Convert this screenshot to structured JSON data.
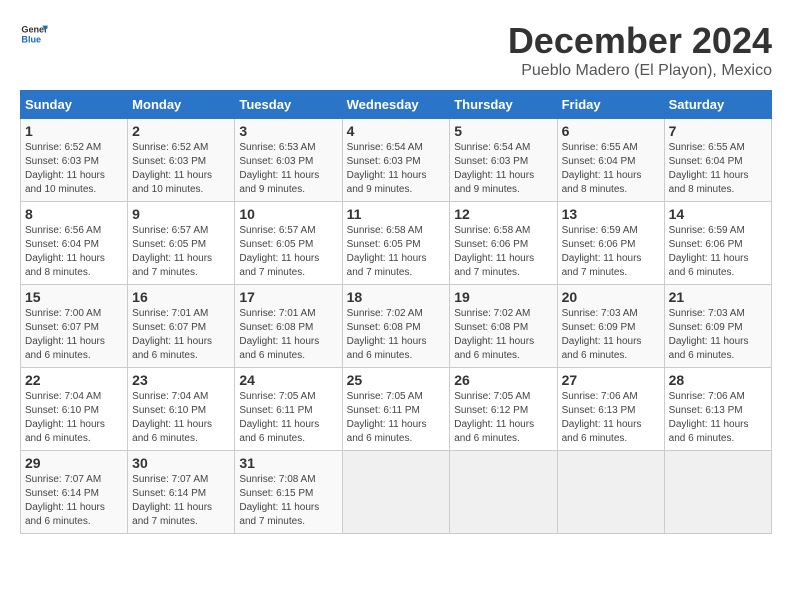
{
  "header": {
    "logo_line1": "General",
    "logo_line2": "Blue",
    "month_title": "December 2024",
    "subtitle": "Pueblo Madero (El Playon), Mexico"
  },
  "weekdays": [
    "Sunday",
    "Monday",
    "Tuesday",
    "Wednesday",
    "Thursday",
    "Friday",
    "Saturday"
  ],
  "weeks": [
    [
      {
        "day": "1",
        "info": "Sunrise: 6:52 AM\nSunset: 6:03 PM\nDaylight: 11 hours\nand 10 minutes."
      },
      {
        "day": "2",
        "info": "Sunrise: 6:52 AM\nSunset: 6:03 PM\nDaylight: 11 hours\nand 10 minutes."
      },
      {
        "day": "3",
        "info": "Sunrise: 6:53 AM\nSunset: 6:03 PM\nDaylight: 11 hours\nand 9 minutes."
      },
      {
        "day": "4",
        "info": "Sunrise: 6:54 AM\nSunset: 6:03 PM\nDaylight: 11 hours\nand 9 minutes."
      },
      {
        "day": "5",
        "info": "Sunrise: 6:54 AM\nSunset: 6:03 PM\nDaylight: 11 hours\nand 9 minutes."
      },
      {
        "day": "6",
        "info": "Sunrise: 6:55 AM\nSunset: 6:04 PM\nDaylight: 11 hours\nand 8 minutes."
      },
      {
        "day": "7",
        "info": "Sunrise: 6:55 AM\nSunset: 6:04 PM\nDaylight: 11 hours\nand 8 minutes."
      }
    ],
    [
      {
        "day": "8",
        "info": "Sunrise: 6:56 AM\nSunset: 6:04 PM\nDaylight: 11 hours\nand 8 minutes."
      },
      {
        "day": "9",
        "info": "Sunrise: 6:57 AM\nSunset: 6:05 PM\nDaylight: 11 hours\nand 7 minutes."
      },
      {
        "day": "10",
        "info": "Sunrise: 6:57 AM\nSunset: 6:05 PM\nDaylight: 11 hours\nand 7 minutes."
      },
      {
        "day": "11",
        "info": "Sunrise: 6:58 AM\nSunset: 6:05 PM\nDaylight: 11 hours\nand 7 minutes."
      },
      {
        "day": "12",
        "info": "Sunrise: 6:58 AM\nSunset: 6:06 PM\nDaylight: 11 hours\nand 7 minutes."
      },
      {
        "day": "13",
        "info": "Sunrise: 6:59 AM\nSunset: 6:06 PM\nDaylight: 11 hours\nand 7 minutes."
      },
      {
        "day": "14",
        "info": "Sunrise: 6:59 AM\nSunset: 6:06 PM\nDaylight: 11 hours\nand 6 minutes."
      }
    ],
    [
      {
        "day": "15",
        "info": "Sunrise: 7:00 AM\nSunset: 6:07 PM\nDaylight: 11 hours\nand 6 minutes."
      },
      {
        "day": "16",
        "info": "Sunrise: 7:01 AM\nSunset: 6:07 PM\nDaylight: 11 hours\nand 6 minutes."
      },
      {
        "day": "17",
        "info": "Sunrise: 7:01 AM\nSunset: 6:08 PM\nDaylight: 11 hours\nand 6 minutes."
      },
      {
        "day": "18",
        "info": "Sunrise: 7:02 AM\nSunset: 6:08 PM\nDaylight: 11 hours\nand 6 minutes."
      },
      {
        "day": "19",
        "info": "Sunrise: 7:02 AM\nSunset: 6:08 PM\nDaylight: 11 hours\nand 6 minutes."
      },
      {
        "day": "20",
        "info": "Sunrise: 7:03 AM\nSunset: 6:09 PM\nDaylight: 11 hours\nand 6 minutes."
      },
      {
        "day": "21",
        "info": "Sunrise: 7:03 AM\nSunset: 6:09 PM\nDaylight: 11 hours\nand 6 minutes."
      }
    ],
    [
      {
        "day": "22",
        "info": "Sunrise: 7:04 AM\nSunset: 6:10 PM\nDaylight: 11 hours\nand 6 minutes."
      },
      {
        "day": "23",
        "info": "Sunrise: 7:04 AM\nSunset: 6:10 PM\nDaylight: 11 hours\nand 6 minutes."
      },
      {
        "day": "24",
        "info": "Sunrise: 7:05 AM\nSunset: 6:11 PM\nDaylight: 11 hours\nand 6 minutes."
      },
      {
        "day": "25",
        "info": "Sunrise: 7:05 AM\nSunset: 6:11 PM\nDaylight: 11 hours\nand 6 minutes."
      },
      {
        "day": "26",
        "info": "Sunrise: 7:05 AM\nSunset: 6:12 PM\nDaylight: 11 hours\nand 6 minutes."
      },
      {
        "day": "27",
        "info": "Sunrise: 7:06 AM\nSunset: 6:13 PM\nDaylight: 11 hours\nand 6 minutes."
      },
      {
        "day": "28",
        "info": "Sunrise: 7:06 AM\nSunset: 6:13 PM\nDaylight: 11 hours\nand 6 minutes."
      }
    ],
    [
      {
        "day": "29",
        "info": "Sunrise: 7:07 AM\nSunset: 6:14 PM\nDaylight: 11 hours\nand 6 minutes."
      },
      {
        "day": "30",
        "info": "Sunrise: 7:07 AM\nSunset: 6:14 PM\nDaylight: 11 hours\nand 7 minutes."
      },
      {
        "day": "31",
        "info": "Sunrise: 7:08 AM\nSunset: 6:15 PM\nDaylight: 11 hours\nand 7 minutes."
      },
      null,
      null,
      null,
      null
    ]
  ]
}
